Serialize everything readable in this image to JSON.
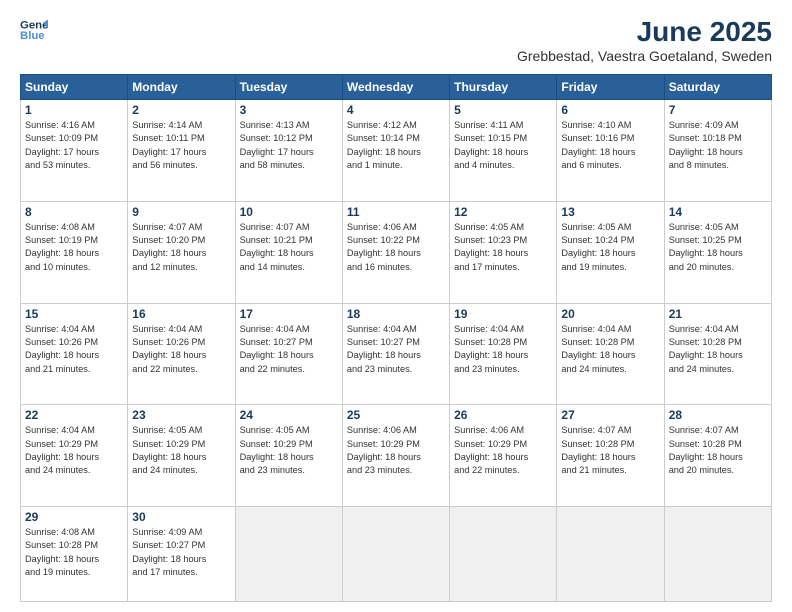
{
  "header": {
    "logo_line1": "General",
    "logo_line2": "Blue",
    "title": "June 2025",
    "subtitle": "Grebbestad, Vaestra Goetaland, Sweden"
  },
  "days_of_week": [
    "Sunday",
    "Monday",
    "Tuesday",
    "Wednesday",
    "Thursday",
    "Friday",
    "Saturday"
  ],
  "weeks": [
    [
      {
        "day": 1,
        "info": "Sunrise: 4:16 AM\nSunset: 10:09 PM\nDaylight: 17 hours\nand 53 minutes."
      },
      {
        "day": 2,
        "info": "Sunrise: 4:14 AM\nSunset: 10:11 PM\nDaylight: 17 hours\nand 56 minutes."
      },
      {
        "day": 3,
        "info": "Sunrise: 4:13 AM\nSunset: 10:12 PM\nDaylight: 17 hours\nand 58 minutes."
      },
      {
        "day": 4,
        "info": "Sunrise: 4:12 AM\nSunset: 10:14 PM\nDaylight: 18 hours\nand 1 minute."
      },
      {
        "day": 5,
        "info": "Sunrise: 4:11 AM\nSunset: 10:15 PM\nDaylight: 18 hours\nand 4 minutes."
      },
      {
        "day": 6,
        "info": "Sunrise: 4:10 AM\nSunset: 10:16 PM\nDaylight: 18 hours\nand 6 minutes."
      },
      {
        "day": 7,
        "info": "Sunrise: 4:09 AM\nSunset: 10:18 PM\nDaylight: 18 hours\nand 8 minutes."
      }
    ],
    [
      {
        "day": 8,
        "info": "Sunrise: 4:08 AM\nSunset: 10:19 PM\nDaylight: 18 hours\nand 10 minutes."
      },
      {
        "day": 9,
        "info": "Sunrise: 4:07 AM\nSunset: 10:20 PM\nDaylight: 18 hours\nand 12 minutes."
      },
      {
        "day": 10,
        "info": "Sunrise: 4:07 AM\nSunset: 10:21 PM\nDaylight: 18 hours\nand 14 minutes."
      },
      {
        "day": 11,
        "info": "Sunrise: 4:06 AM\nSunset: 10:22 PM\nDaylight: 18 hours\nand 16 minutes."
      },
      {
        "day": 12,
        "info": "Sunrise: 4:05 AM\nSunset: 10:23 PM\nDaylight: 18 hours\nand 17 minutes."
      },
      {
        "day": 13,
        "info": "Sunrise: 4:05 AM\nSunset: 10:24 PM\nDaylight: 18 hours\nand 19 minutes."
      },
      {
        "day": 14,
        "info": "Sunrise: 4:05 AM\nSunset: 10:25 PM\nDaylight: 18 hours\nand 20 minutes."
      }
    ],
    [
      {
        "day": 15,
        "info": "Sunrise: 4:04 AM\nSunset: 10:26 PM\nDaylight: 18 hours\nand 21 minutes."
      },
      {
        "day": 16,
        "info": "Sunrise: 4:04 AM\nSunset: 10:26 PM\nDaylight: 18 hours\nand 22 minutes."
      },
      {
        "day": 17,
        "info": "Sunrise: 4:04 AM\nSunset: 10:27 PM\nDaylight: 18 hours\nand 22 minutes."
      },
      {
        "day": 18,
        "info": "Sunrise: 4:04 AM\nSunset: 10:27 PM\nDaylight: 18 hours\nand 23 minutes."
      },
      {
        "day": 19,
        "info": "Sunrise: 4:04 AM\nSunset: 10:28 PM\nDaylight: 18 hours\nand 23 minutes."
      },
      {
        "day": 20,
        "info": "Sunrise: 4:04 AM\nSunset: 10:28 PM\nDaylight: 18 hours\nand 24 minutes."
      },
      {
        "day": 21,
        "info": "Sunrise: 4:04 AM\nSunset: 10:28 PM\nDaylight: 18 hours\nand 24 minutes."
      }
    ],
    [
      {
        "day": 22,
        "info": "Sunrise: 4:04 AM\nSunset: 10:29 PM\nDaylight: 18 hours\nand 24 minutes."
      },
      {
        "day": 23,
        "info": "Sunrise: 4:05 AM\nSunset: 10:29 PM\nDaylight: 18 hours\nand 24 minutes."
      },
      {
        "day": 24,
        "info": "Sunrise: 4:05 AM\nSunset: 10:29 PM\nDaylight: 18 hours\nand 23 minutes."
      },
      {
        "day": 25,
        "info": "Sunrise: 4:06 AM\nSunset: 10:29 PM\nDaylight: 18 hours\nand 23 minutes."
      },
      {
        "day": 26,
        "info": "Sunrise: 4:06 AM\nSunset: 10:29 PM\nDaylight: 18 hours\nand 22 minutes."
      },
      {
        "day": 27,
        "info": "Sunrise: 4:07 AM\nSunset: 10:28 PM\nDaylight: 18 hours\nand 21 minutes."
      },
      {
        "day": 28,
        "info": "Sunrise: 4:07 AM\nSunset: 10:28 PM\nDaylight: 18 hours\nand 20 minutes."
      }
    ],
    [
      {
        "day": 29,
        "info": "Sunrise: 4:08 AM\nSunset: 10:28 PM\nDaylight: 18 hours\nand 19 minutes."
      },
      {
        "day": 30,
        "info": "Sunrise: 4:09 AM\nSunset: 10:27 PM\nDaylight: 18 hours\nand 17 minutes."
      },
      {
        "day": null,
        "info": ""
      },
      {
        "day": null,
        "info": ""
      },
      {
        "day": null,
        "info": ""
      },
      {
        "day": null,
        "info": ""
      },
      {
        "day": null,
        "info": ""
      }
    ]
  ]
}
